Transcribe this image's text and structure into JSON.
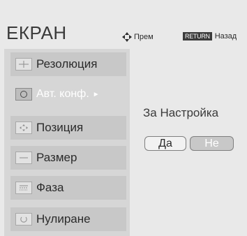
{
  "header": {
    "title": "ЕКРАН",
    "help_move": "Прем",
    "help_return_badge": "RETURN",
    "help_return": "Назад"
  },
  "menu": {
    "items": [
      {
        "label": "Резолюция",
        "icon": "resolution-icon"
      },
      {
        "label": "Авт. конф.",
        "icon": "auto-config-icon",
        "active": true
      },
      {
        "label": "Позиция",
        "icon": "position-icon"
      },
      {
        "label": "Размер",
        "icon": "size-icon"
      },
      {
        "label": "Фаза",
        "icon": "phase-icon"
      },
      {
        "label": "Нулиране",
        "icon": "reset-icon"
      }
    ],
    "active_arrow": "►"
  },
  "dialog": {
    "prompt": "За Настройка",
    "yes_label": "Да",
    "no_label": "Не"
  }
}
